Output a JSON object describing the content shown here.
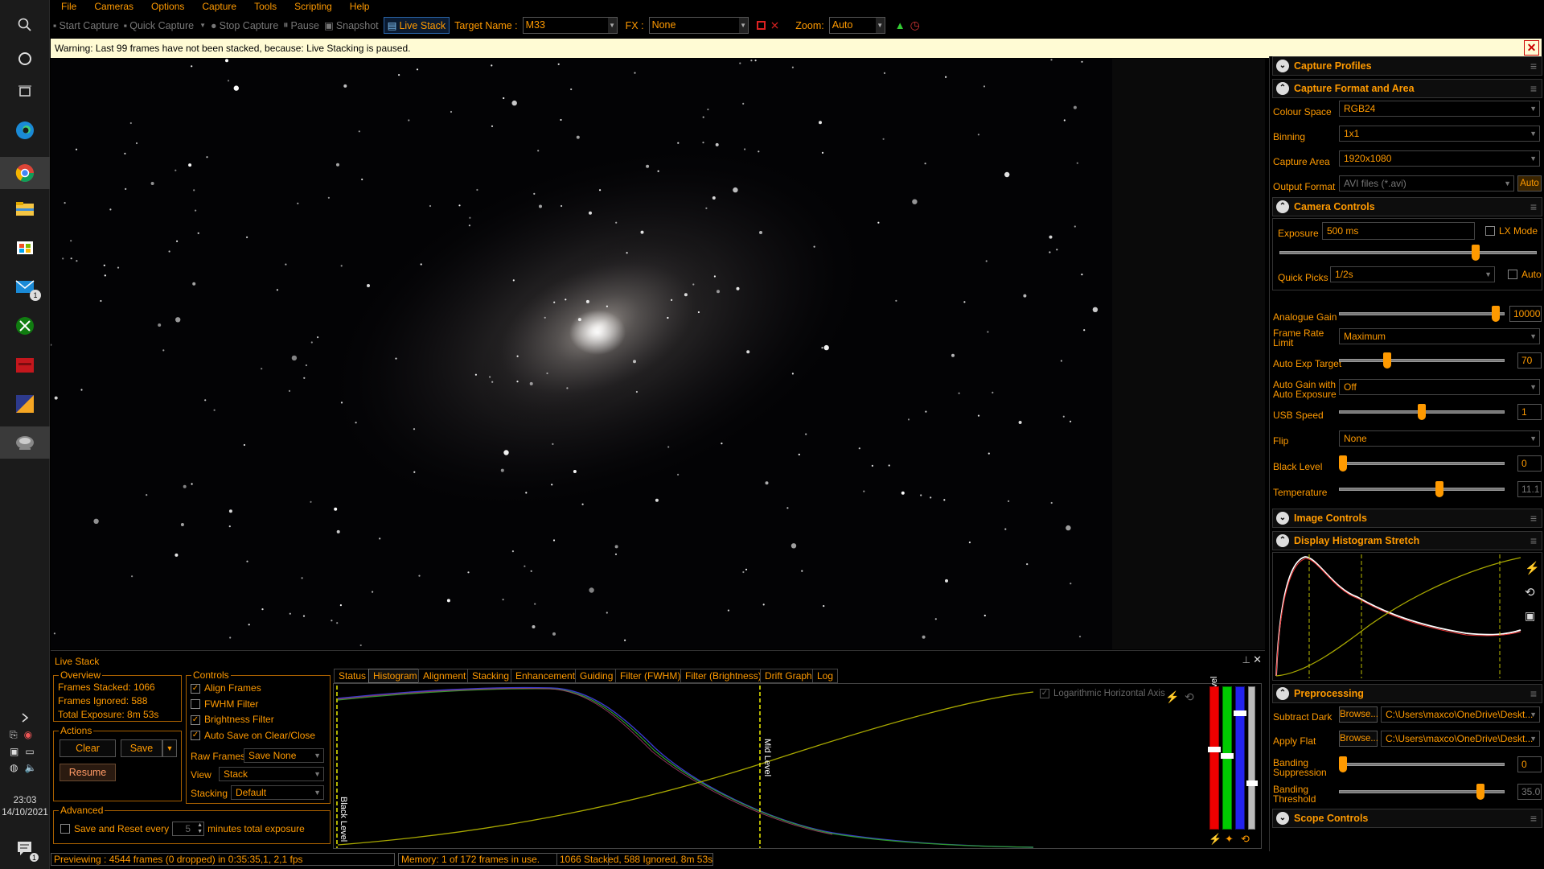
{
  "menu": [
    "File",
    "Cameras",
    "Options",
    "Capture",
    "Tools",
    "Scripting",
    "Help"
  ],
  "toolbar": {
    "start_capture": "Start Capture",
    "quick_capture": "Quick Capture",
    "stop_capture": "Stop Capture",
    "pause": "Pause",
    "snapshot": "Snapshot",
    "live_stack": "Live Stack",
    "target_name_label": "Target Name :",
    "target_name_value": "M33",
    "fx_label": "FX :",
    "fx_value": "None",
    "zoom_label": "Zoom:",
    "zoom_value": "Auto"
  },
  "warning": "Warning: Last 99 frames have not been stacked, because: Live Stacking is paused.",
  "live_stack": {
    "title": "Live Stack",
    "overview": {
      "title": "Overview",
      "frames_stacked": "Frames Stacked:  1066",
      "frames_ignored": "Frames Ignored:  588",
      "total_exposure": "Total Exposure:  8m 53s"
    },
    "actions": {
      "title": "Actions",
      "clear": "Clear",
      "save": "Save",
      "resume": "Resume"
    },
    "controls": {
      "title": "Controls",
      "align_frames": "Align Frames",
      "fwhm_filter": "FWHM Filter",
      "brightness_filter": "Brightness Filter",
      "auto_save": "Auto Save on Clear/Close",
      "raw_frames_label": "Raw Frames",
      "raw_frames_value": "Save None",
      "view_label": "View",
      "view_value": "Stack",
      "stacking_label": "Stacking",
      "stacking_value": "Default"
    },
    "advanced": {
      "title": "Advanced",
      "save_reset_label": "Save and Reset every",
      "minutes_value": "5",
      "minutes_label": "minutes total exposure"
    },
    "tabs": [
      "Status",
      "Histogram",
      "Alignment",
      "Stacking",
      "Enhancement",
      "Guiding",
      "Filter (FWHM)",
      "Filter (Brightness)",
      "Drift Graph",
      "Log"
    ],
    "selected_tab": "Histogram",
    "histogram": {
      "log_axis_label": "Logarithmic Horizontal Axis",
      "black_level_label": "Black Level",
      "mid_level_label": "Mid Level",
      "white_level_label": "White Level"
    }
  },
  "status_bar": {
    "preview": "Previewing : 4544 frames (0 dropped) in 0:35:35,1, 2,1 fps",
    "memory": "Memory: 1 of 172 frames in use.",
    "stack": "1066 Stacked, 588 Ignored, 8m 53s"
  },
  "taskbar": {
    "time": "23:03",
    "date": "14/10/2021",
    "mail_badge": "1",
    "notif_badge": "1"
  },
  "right_panel": {
    "capture_profiles": "Capture Profiles",
    "capture_format": {
      "title": "Capture Format and Area",
      "colour_space_label": "Colour Space",
      "colour_space": "RGB24",
      "binning_label": "Binning",
      "binning": "1x1",
      "capture_area_label": "Capture Area",
      "capture_area": "1920x1080",
      "output_format_label": "Output Format",
      "output_format": "AVI files (*.avi)",
      "auto_button": "Auto"
    },
    "camera_controls": {
      "title": "Camera Controls",
      "exposure_label": "Exposure",
      "exposure": "500 ms",
      "lx_mode": "LX Mode",
      "quick_picks_label": "Quick Picks",
      "quick_picks": "1/2s",
      "auto": "Auto",
      "analogue_gain_label": "Analogue Gain",
      "analogue_gain": "10000",
      "frame_rate_label": "Frame Rate Limit",
      "frame_rate": "Maximum",
      "auto_exp_target_label": "Auto Exp Target",
      "auto_exp_target": "70",
      "auto_gain_label": "Auto Gain with Auto Exposure",
      "auto_gain": "Off",
      "usb_speed_label": "USB Speed",
      "usb_speed": "1",
      "flip_label": "Flip",
      "flip": "None",
      "black_level_label": "Black Level",
      "black_level": "0",
      "temperature_label": "Temperature",
      "temperature": "11.1"
    },
    "image_controls": "Image Controls",
    "display_histogram": "Display Histogram Stretch",
    "preprocessing": {
      "title": "Preprocessing",
      "subtract_dark_label": "Subtract Dark",
      "browse": "Browse...",
      "dark_path": "C:\\Users\\maxco\\OneDrive\\Deskt...",
      "apply_flat_label": "Apply Flat",
      "flat_path": "C:\\Users\\maxco\\OneDrive\\Deskt...",
      "banding_supp_label": "Banding Suppression",
      "banding_supp": "0",
      "banding_thresh_label": "Banding Threshold",
      "banding_thresh": "35.0"
    },
    "scope_controls": "Scope Controls"
  },
  "sliders": {
    "exposure": 0.77,
    "analogue_gain": 0.97,
    "auto_exp_target": 0.28,
    "usb_speed": 0.5,
    "black_level": 0.0,
    "temperature": 0.61,
    "banding_supp": 0.0,
    "banding_thresh": 0.87
  },
  "colors": {
    "accent": "#ff9a00",
    "warning_bg": "#fffbd4",
    "selected_border": "#2a64a8"
  }
}
